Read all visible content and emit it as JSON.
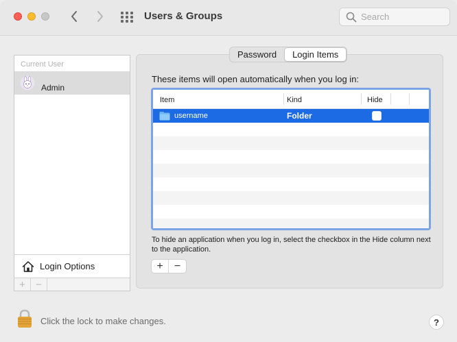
{
  "window": {
    "title": "Users & Groups",
    "search_placeholder": "Search"
  },
  "sidebar": {
    "section_label": "Current User",
    "users": [
      {
        "name": "Admin",
        "avatar": "rabbit-avatar-icon"
      }
    ],
    "login_options_label": "Login Options",
    "footer": {
      "add": "+",
      "remove": "−"
    }
  },
  "tabs": [
    {
      "label": "Password",
      "active": false
    },
    {
      "label": "Login Items",
      "active": true
    }
  ],
  "login_items": {
    "intro": "These items will open automatically when you log in:",
    "columns": {
      "item": "Item",
      "kind": "Kind",
      "hide": "Hide"
    },
    "rows": [
      {
        "item": "username",
        "kind": "Folder",
        "hide": false,
        "icon": "folder-icon"
      }
    ],
    "help_text": "To hide an application when you log in, select the checkbox in the Hide column next to the application.",
    "add_label": "+",
    "remove_label": "−"
  },
  "footer": {
    "lock_text": "Click the lock to make changes.",
    "help_label": "?"
  },
  "colors": {
    "selection": "#1c6ae4",
    "focus_ring": "#7aa4e6",
    "close": "#fe5f57",
    "minimize": "#febc2e",
    "lock_gold": "#e3a43a"
  }
}
